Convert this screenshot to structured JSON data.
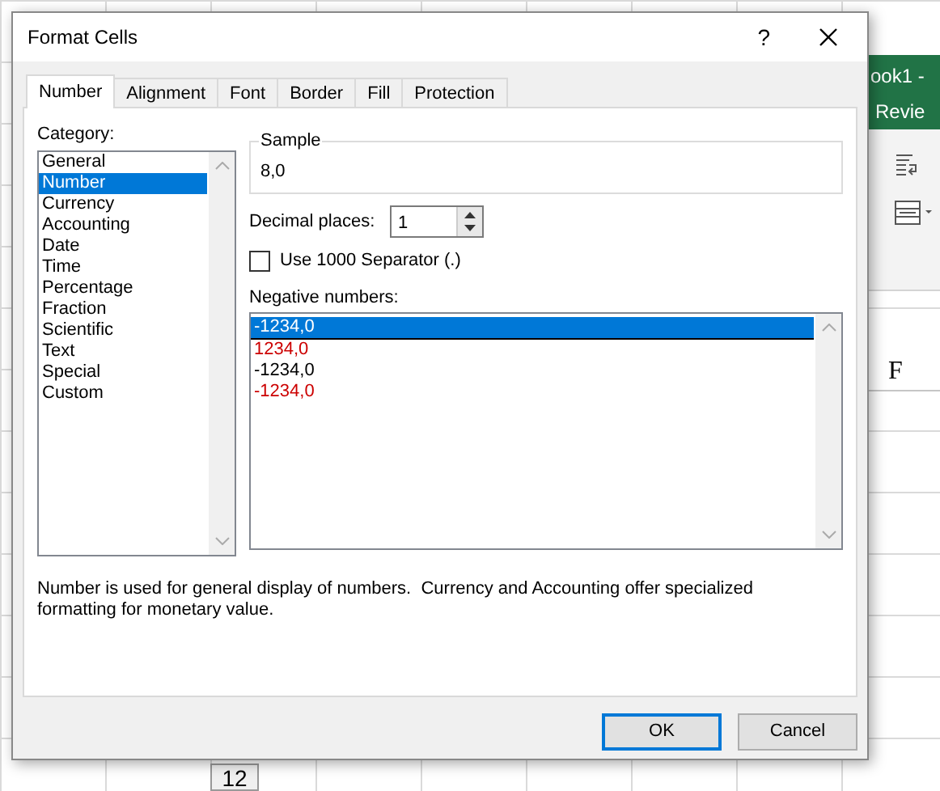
{
  "background": {
    "app_title": "ook1 -",
    "ribbon_tab": "Revie",
    "column_header": "F",
    "bottom_row_number": "12"
  },
  "window": {
    "title": "Format Cells",
    "help": "?"
  },
  "tabs": [
    {
      "label": "Number",
      "selected": true
    },
    {
      "label": "Alignment",
      "selected": false
    },
    {
      "label": "Font",
      "selected": false
    },
    {
      "label": "Border",
      "selected": false
    },
    {
      "label": "Fill",
      "selected": false
    },
    {
      "label": "Protection",
      "selected": false
    }
  ],
  "category": {
    "label": "Category:",
    "items": [
      {
        "label": "General",
        "selected": false
      },
      {
        "label": "Number",
        "selected": true
      },
      {
        "label": "Currency",
        "selected": false
      },
      {
        "label": "Accounting",
        "selected": false
      },
      {
        "label": "Date",
        "selected": false
      },
      {
        "label": "Time",
        "selected": false
      },
      {
        "label": "Percentage",
        "selected": false
      },
      {
        "label": "Fraction",
        "selected": false
      },
      {
        "label": "Scientific",
        "selected": false
      },
      {
        "label": "Text",
        "selected": false
      },
      {
        "label": "Special",
        "selected": false
      },
      {
        "label": "Custom",
        "selected": false
      }
    ]
  },
  "sample": {
    "label": "Sample",
    "value": "8,0"
  },
  "decimal_places": {
    "label": "Decimal places:",
    "value": "1"
  },
  "separator": {
    "label": "Use 1000 Separator (.)",
    "checked": false
  },
  "negative_numbers": {
    "label": "Negative numbers:",
    "items": [
      {
        "label": "-1234,0",
        "color": "#000000",
        "selected": true
      },
      {
        "label": "1234,0",
        "color": "#cc0000",
        "selected": false
      },
      {
        "label": "-1234,0",
        "color": "#000000",
        "selected": false
      },
      {
        "label": "-1234,0",
        "color": "#cc0000",
        "selected": false
      }
    ]
  },
  "description": "Number is used for general display of numbers.  Currency and Accounting offer specialized formatting for monetary value.",
  "buttons": [
    {
      "label": "OK",
      "kind": "default"
    },
    {
      "label": "Cancel",
      "kind": "normal"
    }
  ]
}
